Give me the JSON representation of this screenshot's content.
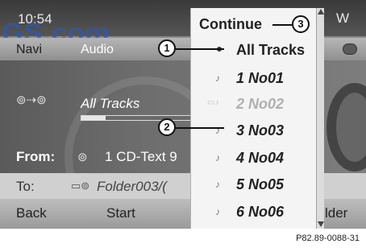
{
  "status": {
    "clock": "10:54",
    "indicator": "W"
  },
  "watermark": "GS.com",
  "menu": {
    "items": [
      "Navi",
      "Audio"
    ],
    "active": "Audio"
  },
  "main": {
    "source_icon": "cd-changer-icon",
    "track_title": "All Tracks",
    "progress": 0.2,
    "from_label": "From:",
    "from_value": "1 CD-Text 9",
    "to_label": "To:",
    "to_value": "Folder003/("
  },
  "softkeys": {
    "back": "Back",
    "start": "Start",
    "right": "lder"
  },
  "dropdown": {
    "header": "Continue",
    "items": [
      {
        "label": "All Tracks",
        "type": "bullet"
      },
      {
        "label": "1 No01",
        "type": "note"
      },
      {
        "label": "2 No02",
        "type": "note-dim"
      },
      {
        "label": "3 No03",
        "type": "note"
      },
      {
        "label": "4 No04",
        "type": "note"
      },
      {
        "label": "5 No05",
        "type": "note"
      },
      {
        "label": "6 No06",
        "type": "note"
      }
    ]
  },
  "callouts": [
    "1",
    "2",
    "3"
  ],
  "ref_code": "P82.89-0088-31"
}
